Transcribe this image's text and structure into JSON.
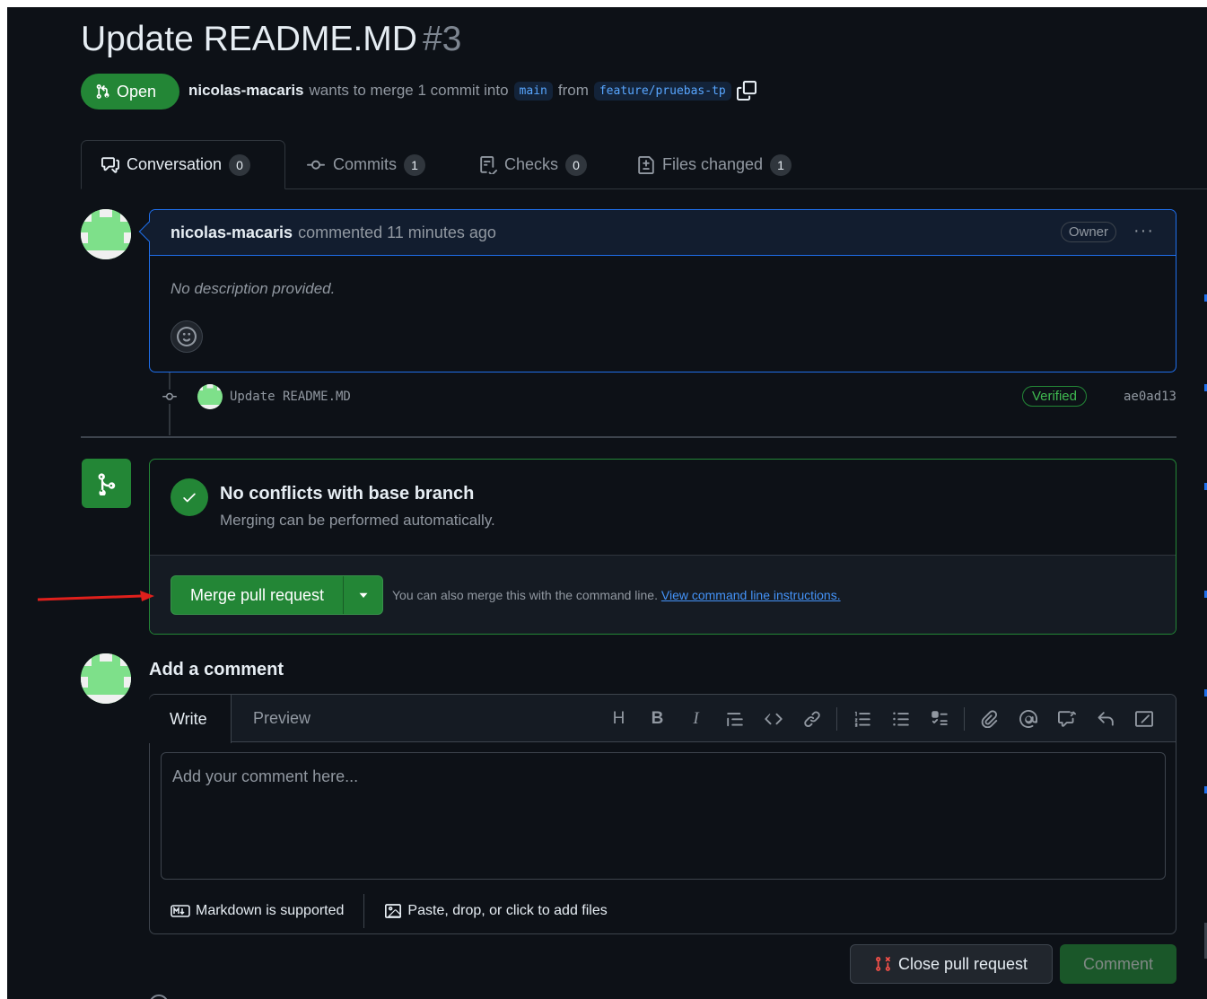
{
  "pr": {
    "title": "Update README.MD",
    "number": "#3",
    "state": "Open",
    "author": "nicolas-macaris",
    "merge_text": "wants to merge 1 commit into",
    "base_branch": "main",
    "from_text": "from",
    "head_branch": "feature/pruebas-tp"
  },
  "tabs": [
    {
      "label": "Conversation",
      "count": "0",
      "icon": "comment-discussion-icon"
    },
    {
      "label": "Commits",
      "count": "1",
      "icon": "git-commit-icon"
    },
    {
      "label": "Checks",
      "count": "0",
      "icon": "checklist-icon"
    },
    {
      "label": "Files changed",
      "count": "1",
      "icon": "file-diff-icon"
    }
  ],
  "comment": {
    "author": "nicolas-macaris",
    "action": "commented 11 minutes ago",
    "role": "Owner",
    "body": "No description provided."
  },
  "commit": {
    "message": "Update README.MD",
    "verified": "Verified",
    "sha": "ae0ad13"
  },
  "merge": {
    "title": "No conflicts with base branch",
    "subtitle": "Merging can be performed automatically.",
    "button": "Merge pull request",
    "hint": "You can also merge this with the command line.",
    "hint_link": "View command line instructions."
  },
  "add_comment": {
    "title": "Add a comment",
    "tab_write": "Write",
    "tab_preview": "Preview",
    "placeholder": "Add your comment here...",
    "markdown_note": "Markdown is supported",
    "files_note": "Paste, drop, or click to add files",
    "toolbar_icons": [
      "heading-icon",
      "bold-icon",
      "italic-icon",
      "quote-icon",
      "code-icon",
      "link-icon",
      "ordered-list-icon",
      "unordered-list-icon",
      "task-list-icon",
      "attach-icon",
      "mention-icon",
      "reference-icon",
      "reply-icon",
      "fullscreen-icon"
    ]
  },
  "actions": {
    "close": "Close pull request",
    "comment": "Comment"
  },
  "colors": {
    "background": "#0d1117",
    "green": "#238636",
    "blue_border": "#1f6feb",
    "arrow": "#e0201c"
  }
}
